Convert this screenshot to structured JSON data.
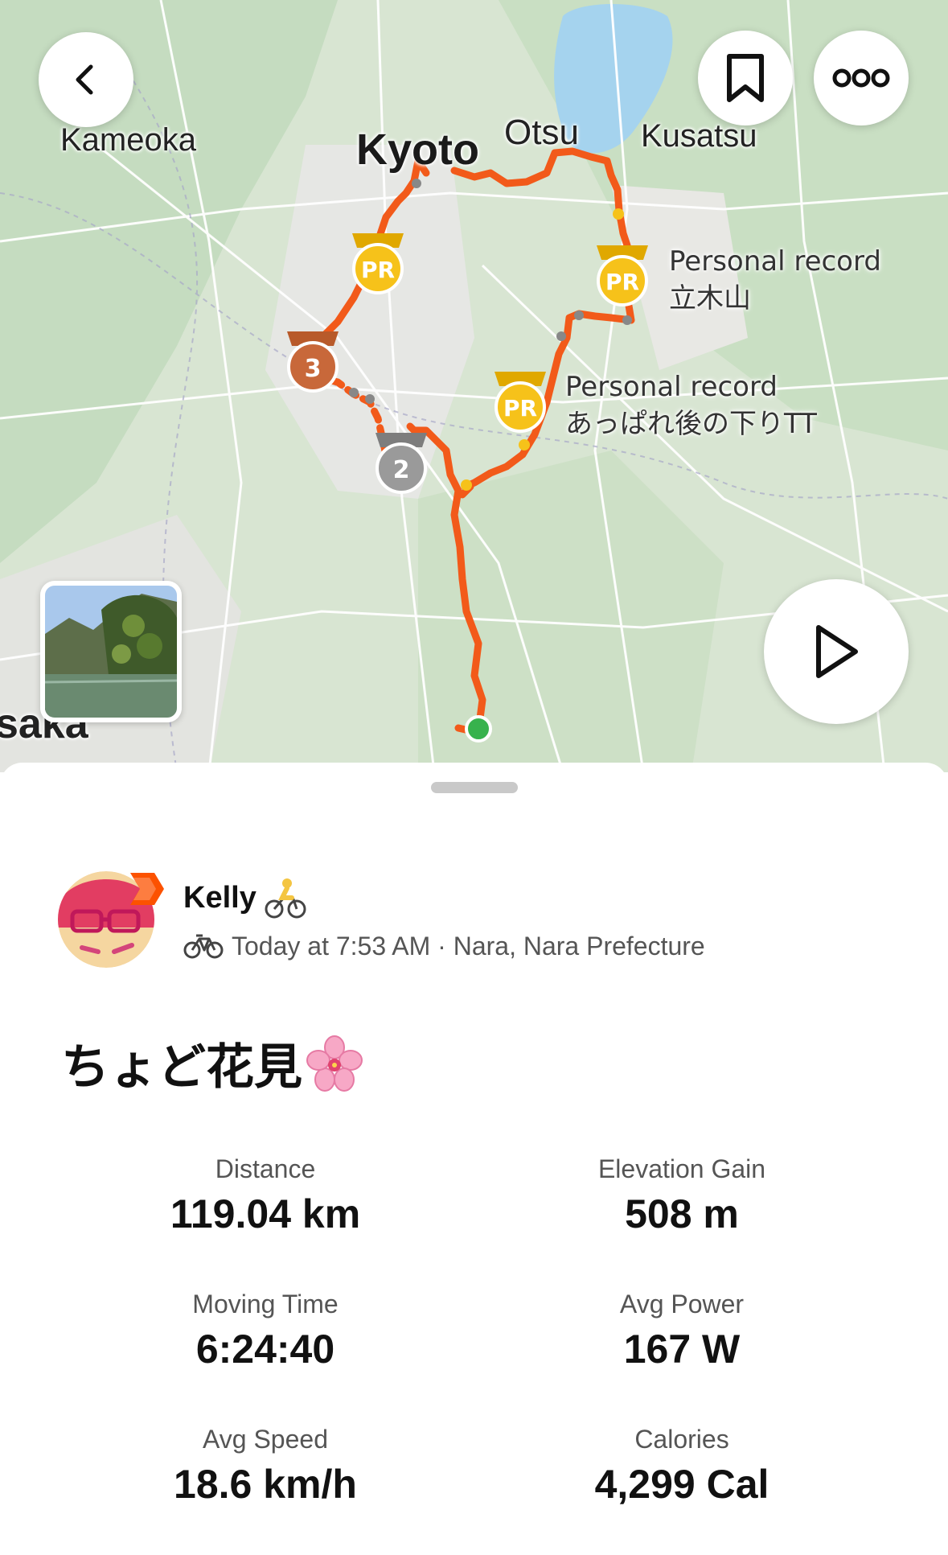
{
  "map": {
    "places": {
      "kameoka": "Kameoka",
      "kyoto": "Kyoto",
      "otsu": "Otsu",
      "kusatsu": "Kusatsu",
      "osaka": "saka"
    },
    "achievements": [
      {
        "title": "Personal record",
        "segment": "立木山"
      },
      {
        "title": "Personal record",
        "segment": "あっぱれ後の下りTT"
      }
    ],
    "route_color": "#f25a1a",
    "start_marker_color": "#37b24d"
  },
  "toolbar": {
    "back_icon": "chevron-left-icon",
    "bookmark_icon": "bookmark-icon",
    "more_icon": "more-dots-icon",
    "play_icon": "play-icon"
  },
  "athlete": {
    "name": "Kelly",
    "name_emoji": "🚴",
    "meta": "Today at 7:53 AM · Nara, Nara Prefecture"
  },
  "activity": {
    "title": "ちょど花見",
    "title_emoji": "🌸"
  },
  "stats": [
    {
      "label": "Distance",
      "value": "119.04 km"
    },
    {
      "label": "Elevation Gain",
      "value": "508 m"
    },
    {
      "label": "Moving Time",
      "value": "6:24:40"
    },
    {
      "label": "Avg Power",
      "value": "167 W"
    },
    {
      "label": "Avg Speed",
      "value": "18.6 km/h"
    },
    {
      "label": "Calories",
      "value": "4,299 Cal"
    }
  ]
}
